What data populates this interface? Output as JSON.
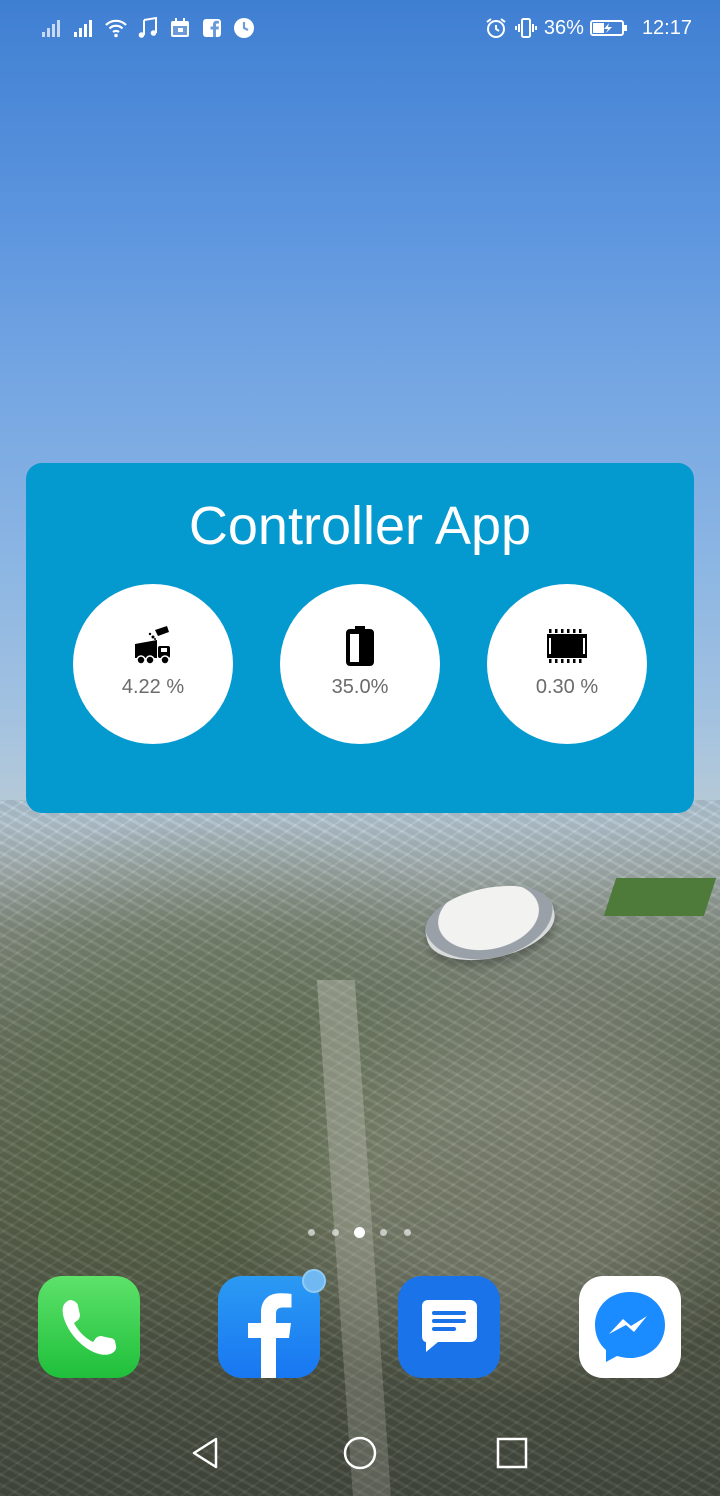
{
  "status_bar": {
    "battery_percent": "36%",
    "time": "12:17",
    "icons_left": [
      "signal-icon",
      "signal-icon",
      "wifi-icon",
      "music-icon",
      "calendar-icon",
      "facebook-notification-icon",
      "clock-icon"
    ],
    "icons_right": [
      "alarm-icon",
      "vibrate-icon",
      "battery-charging-icon"
    ]
  },
  "widget": {
    "title": "Controller App",
    "background": "#0499cf",
    "stats": [
      {
        "icon": "truck-dump-icon",
        "value": "4.22 %"
      },
      {
        "icon": "battery-icon",
        "value": "35.0%"
      },
      {
        "icon": "memory-chip-icon",
        "value": "0.30 %"
      }
    ]
  },
  "page_indicator": {
    "count": 5,
    "active_index": 2
  },
  "dock": [
    {
      "name": "Phone",
      "icon": "phone-icon",
      "color": "#2cc84a"
    },
    {
      "name": "Facebook",
      "icon": "facebook-icon",
      "color": "#1877f2",
      "has_notification": true
    },
    {
      "name": "Messages",
      "icon": "messages-icon",
      "color": "#1a73e8"
    },
    {
      "name": "Messenger",
      "icon": "messenger-icon",
      "color": "#ffffff"
    }
  ],
  "nav_bar": {
    "buttons": [
      "back-icon",
      "home-icon",
      "recents-icon"
    ]
  }
}
